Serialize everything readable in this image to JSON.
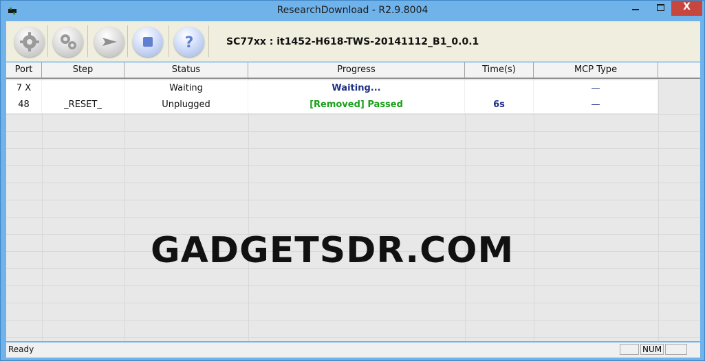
{
  "window": {
    "title": "ResearchDownload - R2.9.8004",
    "controls": {
      "close_symbol": "X"
    }
  },
  "toolbar": {
    "buttons": [
      {
        "name": "load-packet-button",
        "icon": "gear-icon",
        "style": "gray"
      },
      {
        "name": "settings-button",
        "icon": "gears-icon",
        "style": "gray"
      },
      {
        "name": "start-button",
        "icon": "play-arrow-icon",
        "style": "gray"
      },
      {
        "name": "stop-button",
        "icon": "stop-square-icon",
        "style": "blue"
      },
      {
        "name": "help-button",
        "icon": "question-icon",
        "style": "blue"
      }
    ],
    "package_label": "SC77xx : it1452-H618-TWS-20141112_B1_0.0.1"
  },
  "table": {
    "columns": [
      "Port",
      "Step",
      "Status",
      "Progress",
      "Time(s)",
      "MCP Type"
    ],
    "rows": [
      {
        "port": "7 X",
        "step": "",
        "status": "Waiting",
        "progress": "Waiting...",
        "time": "",
        "mcp": "—"
      },
      {
        "port": "48",
        "step": "_RESET_",
        "status": "Unplugged",
        "progress": "[Removed] Passed",
        "time": "6s",
        "mcp": "—"
      }
    ],
    "progress_colors": [
      "#1f2f86",
      "#18a018"
    ],
    "time_color": "#1f2f86",
    "mcp_color": "#1f2f86"
  },
  "watermark": "GADGETSDR.COM",
  "statusbar": {
    "text": "Ready",
    "indicators": [
      "",
      "NUM",
      ""
    ]
  },
  "colors": {
    "title_bar": "#6fb3ea",
    "close_button": "#c7463d"
  }
}
